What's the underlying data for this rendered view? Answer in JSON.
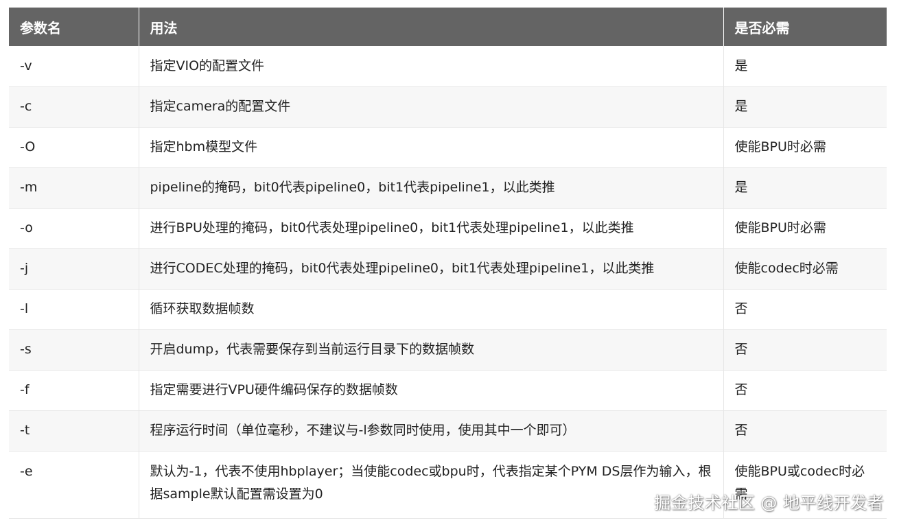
{
  "table": {
    "headers": [
      "参数名",
      "用法",
      "是否必需"
    ],
    "rows": [
      {
        "param": "-v",
        "usage": "指定VIO的配置文件",
        "required": "是"
      },
      {
        "param": "-c",
        "usage": "指定camera的配置文件",
        "required": "是"
      },
      {
        "param": "-O",
        "usage": "指定hbm模型文件",
        "required": "使能BPU时必需"
      },
      {
        "param": "-m",
        "usage": "pipeline的掩码，bit0代表pipeline0，bit1代表pipeline1，以此类推",
        "required": "是"
      },
      {
        "param": "-o",
        "usage": "进行BPU处理的掩码，bit0代表处理pipeline0，bit1代表处理pipeline1，以此类推",
        "required": "使能BPU时必需"
      },
      {
        "param": "-j",
        "usage": "进行CODEC处理的掩码，bit0代表处理pipeline0，bit1代表处理pipeline1，以此类推",
        "required": "使能codec时必需"
      },
      {
        "param": "-l",
        "usage": "循环获取数据帧数",
        "required": "否"
      },
      {
        "param": "-s",
        "usage": "开启dump，代表需要保存到当前运行目录下的数据帧数",
        "required": "否"
      },
      {
        "param": "-f",
        "usage": "指定需要进行VPU硬件编码保存的数据帧数",
        "required": "否"
      },
      {
        "param": "-t",
        "usage": "程序运行时间（单位毫秒，不建议与-l参数同时使用，使用其中一个即可）",
        "required": "否"
      },
      {
        "param": "-e",
        "usage": "默认为-1，代表不使用hbplayer；当使能codec或bpu时，代表指定某个PYM DS层作为输入，根据sample默认配置需设置为0",
        "required": "使能BPU或codec时必需"
      }
    ]
  },
  "watermark": "掘金技术社区 @ 地平线开发者"
}
